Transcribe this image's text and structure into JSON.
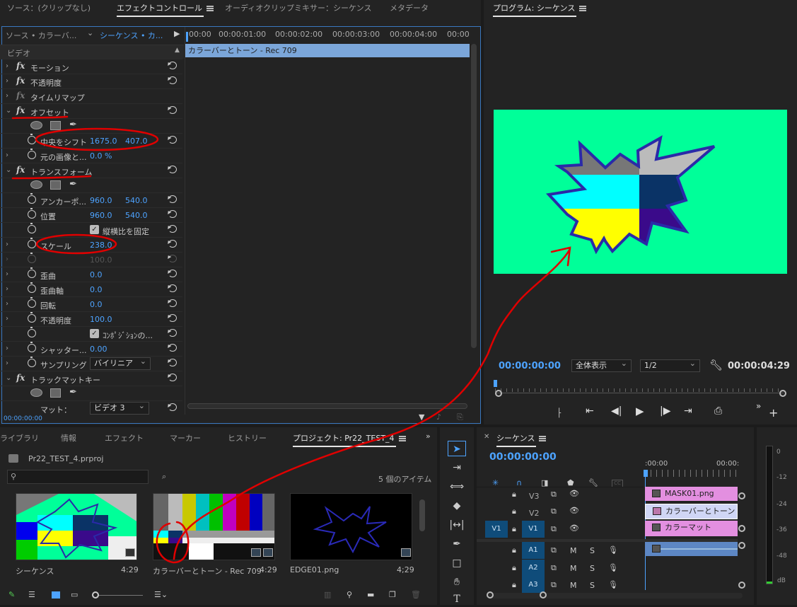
{
  "effect_panel": {
    "tabs": [
      "ソース：(クリップなし)",
      "エフェクトコントロール",
      "オーディオクリップミキサー：シーケンス",
      "メタデータ"
    ],
    "source_label": "ソース • カラーバ...",
    "sequence_label": "シーケンス • カ...",
    "section_video": "ビデオ",
    "timecodes": [
      "00:00",
      "00:00:01:00",
      "00:00:02:00",
      "00:00:03:00",
      "00:00:04:00",
      "00:00"
    ],
    "clip_bar": "カラーバーとトーン - Rec 709",
    "bottom_timecode": "00:00:00:00",
    "rows": [
      {
        "label": "モーション"
      },
      {
        "label": "不透明度"
      },
      {
        "label": "タイムリマップ"
      },
      {
        "label": "オフセット"
      },
      {
        "label": "中央をシフト",
        "v1": "1675.0",
        "v2": "407.0"
      },
      {
        "label": "元の画像と...",
        "v1": "0.0 %"
      },
      {
        "label": "トランスフォーム"
      },
      {
        "label": "アンカーポ...",
        "v1": "960.0",
        "v2": "540.0"
      },
      {
        "label": "位置",
        "v1": "960.0",
        "v2": "540.0"
      },
      {
        "label": "縦横比を固定"
      },
      {
        "label": "スケール",
        "v1": "238.0"
      },
      {
        "label": "",
        "v1": "100.0"
      },
      {
        "label": "歪曲",
        "v1": "0.0"
      },
      {
        "label": "歪曲軸",
        "v1": "0.0"
      },
      {
        "label": "回転",
        "v1": "0.0"
      },
      {
        "label": "不透明度",
        "v1": "100.0"
      },
      {
        "label": "ｺﾝﾎﾟｼﾞｼｮﾝの..."
      },
      {
        "label": "シャッター...",
        "v1": "0.00"
      },
      {
        "label": "サンプリング",
        "select": "バイリニア"
      },
      {
        "label": "トラックマットキー"
      },
      {
        "label": "マット：",
        "select": "ビデオ 3"
      }
    ]
  },
  "program": {
    "title": "プログラム: シーケンス",
    "timecode_left": "00:00:00:00",
    "zoom": "全体表示",
    "resolution": "1/2",
    "timecode_right": "00:00:04:29",
    "colors": {
      "bg": "#00ff99",
      "cyan": "#00ffff",
      "navy": "#0a3366",
      "yellow": "#ffff00",
      "purple": "#3a0a8a",
      "gray": "#777777",
      "light": "#bbbbbb",
      "outline": "#2a2aa8"
    }
  },
  "project": {
    "tabs": [
      "ライブラリ",
      "情報",
      "エフェクト",
      "マーカー",
      "ヒストリー",
      "プロジェクト: Pr22_TEST_4"
    ],
    "file": "Pr22_TEST_4.prproj",
    "item_count": "5 個のアイテム",
    "items": [
      {
        "name": "シーケンス",
        "duration": "4:29"
      },
      {
        "name": "カラーバーとトーン - Rec 709",
        "duration": "4:29"
      },
      {
        "name": "EDGE01.png",
        "duration": "4;29"
      }
    ]
  },
  "timeline": {
    "title": "シーケンス",
    "timecode": "00:00:00:00",
    "ruler": [
      ":00:00",
      "00:00:"
    ],
    "video_tracks": [
      {
        "label": "V3",
        "clip": "MASK01.png"
      },
      {
        "label": "V2",
        "clip": "カラーバーとトーン -"
      },
      {
        "label": "V1",
        "src": "V1",
        "clip": "カラーマット"
      }
    ],
    "audio_tracks": [
      {
        "label": "A1",
        "m": "M",
        "s": "S"
      },
      {
        "label": "A2",
        "m": "M",
        "s": "S"
      },
      {
        "label": "A3",
        "m": "M",
        "s": "S"
      }
    ]
  },
  "meter": {
    "scale": [
      "0",
      "-12",
      "-24",
      "-36",
      "-48",
      "dB"
    ]
  }
}
